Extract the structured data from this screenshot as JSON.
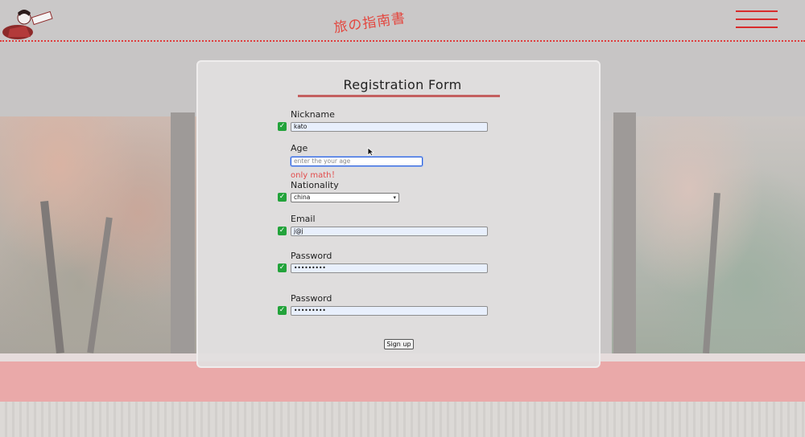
{
  "header": {
    "site_title": "旅の指南書",
    "menu_icon": "hamburger-menu-icon",
    "logo_icon": "geisha-logo-icon",
    "accent_color": "#e3473f"
  },
  "form": {
    "title": "Registration Form",
    "fields": [
      {
        "label": "Nickname",
        "value": "kato",
        "valid": true
      },
      {
        "label": "Age",
        "value": "",
        "placeholder": "enter the your age",
        "error": "only math！",
        "focused": true
      },
      {
        "label": "Nationality",
        "value": "china",
        "valid": true
      },
      {
        "label": "Email",
        "value": "j@j",
        "valid": true
      },
      {
        "label": "Password",
        "value": "•••••••••",
        "valid": true
      },
      {
        "label": "Password",
        "value": "•••••••••",
        "valid": true
      }
    ],
    "submit_label": "Sign up",
    "check_icon": "check-icon",
    "valid_color": "#23a33b",
    "error_color": "#e24b4b"
  }
}
